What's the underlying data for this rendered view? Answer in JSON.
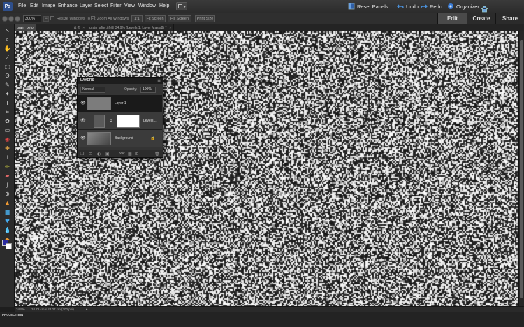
{
  "app": {
    "logo": "Ps"
  },
  "menu": {
    "items": [
      "File",
      "Edit",
      "Image",
      "Enhance",
      "Layer",
      "Select",
      "Filter",
      "View",
      "Window",
      "Help"
    ],
    "reset_panels": "Reset Panels",
    "undo": "Undo",
    "redo": "Redo",
    "organizer": "Organizer"
  },
  "options": {
    "zoom_value": "300%",
    "resize_windows": "Resize Windows To Fit",
    "zoom_all": "Zoom All Windows",
    "btn_1to1": "1:1",
    "btn_fit_screen": "Fit Screen",
    "btn_fill_screen": "Fill Screen",
    "btn_print_size": "Print Size"
  },
  "mode_tabs": {
    "edit": "Edit",
    "create": "Create",
    "share": "Share",
    "active": "Edit"
  },
  "doc_tabs": [
    {
      "label": "grain_befo",
      "active": true
    },
    {
      "label": "& ©",
      "active": false
    },
    {
      "label": "grain_after.tif @ 34.9% (Levels 1, Layer Mask/8) *",
      "active": false
    }
  ],
  "layers_panel": {
    "title": "LAYERS",
    "blend_mode": "Normal",
    "opacity_label": "Opacity:",
    "opacity_value": "100%",
    "layers": [
      {
        "name": "Layer 1",
        "active": true
      },
      {
        "name": "Levels ...",
        "active": false
      },
      {
        "name": "Background",
        "active": false
      }
    ],
    "lock_label": "Lock:"
  },
  "status": {
    "zoom": "34.9%",
    "doc_size": "34.78 cm x 23.07 cm (300 ppi)"
  },
  "project_bin": {
    "label": "PROJECT BIN"
  },
  "colors": {
    "foreground": "#2b2ba0",
    "background": "#ffffff",
    "accent": "#4a90d9"
  }
}
